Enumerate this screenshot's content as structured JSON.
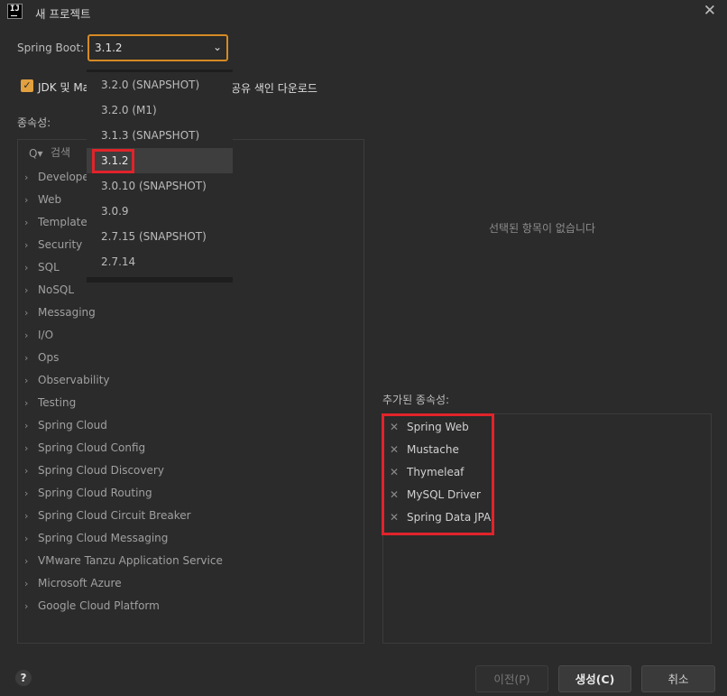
{
  "window": {
    "title": "새 프로젝트",
    "close_icon": "✕",
    "logo_text": "IJ"
  },
  "spring_boot": {
    "label": "Spring Boot:",
    "selected": "3.1.2",
    "chevron": "⌄"
  },
  "jdk_option": {
    "checked": true,
    "label_start": "JDK 및 Ma",
    "label_end": "공유 색인 다운로드"
  },
  "dependencies": {
    "label": "종속성:",
    "search_icon": "🔍",
    "search_placeholder": "검색",
    "categories": [
      "Developer Tools",
      "Web",
      "Template Engines",
      "Security",
      "SQL",
      "NoSQL",
      "Messaging",
      "I/O",
      "Ops",
      "Observability",
      "Testing",
      "Spring Cloud",
      "Spring Cloud Config",
      "Spring Cloud Discovery",
      "Spring Cloud Routing",
      "Spring Cloud Circuit Breaker",
      "Spring Cloud Messaging",
      "VMware Tanzu Application Service",
      "Microsoft Azure",
      "Google Cloud Platform"
    ]
  },
  "version_dropdown": {
    "options": [
      "3.2.0 (SNAPSHOT)",
      "3.2.0 (M1)",
      "3.1.3 (SNAPSHOT)",
      "3.1.2",
      "3.0.10 (SNAPSHOT)",
      "3.0.9",
      "2.7.15 (SNAPSHOT)",
      "2.7.14"
    ],
    "selected_index": 3
  },
  "selected_panel": {
    "empty_text": "선택된 항목이 없습니다"
  },
  "added": {
    "label": "추가된 종속성:",
    "remove_icon": "✕",
    "items": [
      "Spring Web",
      "Mustache",
      "Thymeleaf",
      "MySQL Driver",
      "Spring Data JPA"
    ]
  },
  "footer": {
    "help_label": "?",
    "prev_label": "이전(P)",
    "create_label": "생성(C)",
    "cancel_label": "취소"
  },
  "colors": {
    "background": "#2b2b2b",
    "accent": "#d58a25",
    "highlight": "#e1232a",
    "checkbox": "#e2a03f"
  }
}
